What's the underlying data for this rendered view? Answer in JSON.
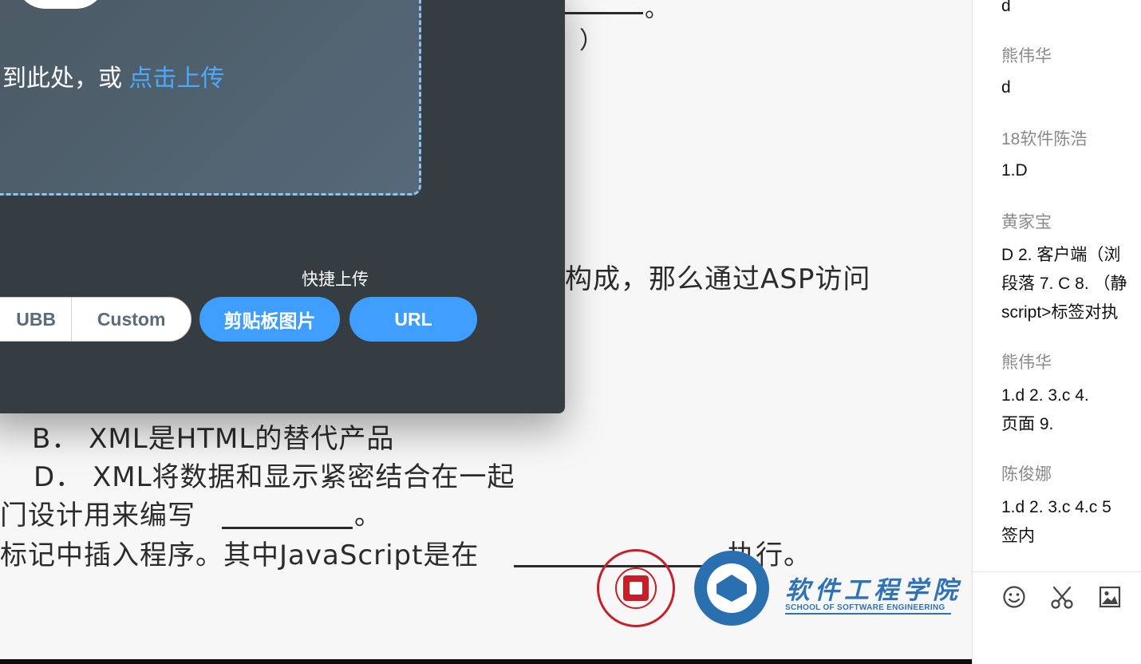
{
  "slide": {
    "blank_mark_top": "。",
    "paren_close": "）",
    "line_asp": "构成，那么通过ASP访问",
    "option_b": "B．  XML是HTML的替代产品",
    "option_d": "D．  XML将数据和显示紧密结合在一起",
    "line_design": "门设计用来编写",
    "line_design_end": "。",
    "line_script": "标记中插入程序。其中JavaScript是在",
    "line_script_end": "执行。",
    "logo_dept_cn": "软件工程学院",
    "logo_dept_en": "SCHOOL OF SOFTWARE ENGINEERING"
  },
  "upload": {
    "drop_prefix": "到此处，或",
    "drop_link": "点击上传",
    "quick_label": "快捷上传",
    "format_ubb": "UBB",
    "format_custom": "Custom",
    "clipboard_button": "剪贴板图片",
    "url_button": "URL"
  },
  "chat": {
    "messages": [
      {
        "name": "",
        "lines": [
          "d"
        ]
      },
      {
        "name": "熊伟华",
        "lines": [
          "d"
        ]
      },
      {
        "name": "18软件陈浩",
        "lines": [
          "1.D"
        ]
      },
      {
        "name": "黄家宝",
        "lines": [
          "D 2. 客户端（浏",
          "段落 7. C 8. （静",
          "script>标签对执"
        ]
      },
      {
        "name": "熊伟华",
        "lines": [
          "1.d    2.    3.c   4.",
          "页面  9."
        ]
      },
      {
        "name": "陈俊娜",
        "lines": [
          "1.d   2.  3.c 4.c 5",
          "签内"
        ]
      }
    ],
    "tools": [
      "emoji-icon",
      "scissors-icon",
      "image-icon"
    ]
  }
}
